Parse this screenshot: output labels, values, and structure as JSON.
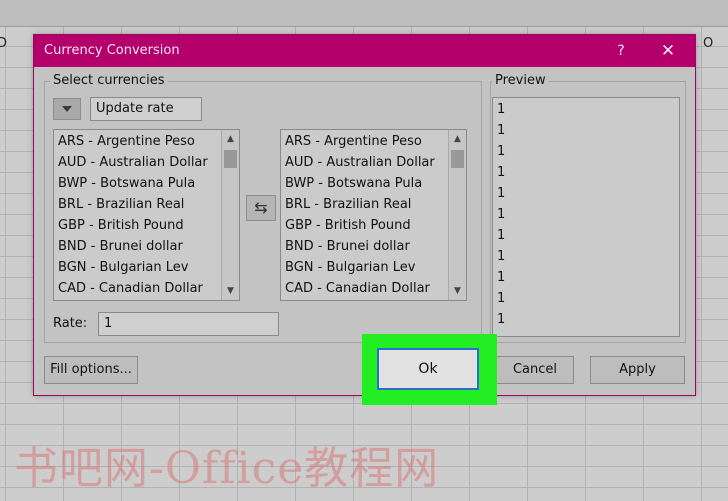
{
  "background": {
    "column_fragments": [
      "D",
      "O"
    ]
  },
  "dialog": {
    "title": "Currency Conversion",
    "help_label": "?",
    "close_label": "✕",
    "select_currencies_label": "Select currencies",
    "update_rate_label": "Update rate",
    "swap_label": "⇆",
    "left_list": [
      "ARS - Argentine Peso",
      "AUD - Australian Dollar",
      "BWP - Botswana Pula",
      "BRL - Brazilian Real",
      "GBP - British Pound",
      "BND - Brunei dollar",
      "BGN - Bulgarian Lev",
      "CAD - Canadian Dollar"
    ],
    "right_list": [
      "ARS - Argentine Peso",
      "AUD - Australian Dollar",
      "BWP - Botswana Pula",
      "BRL - Brazilian Real",
      "GBP - British Pound",
      "BND - Brunei dollar",
      "BGN - Bulgarian Lev",
      "CAD - Canadian Dollar"
    ],
    "rate_label": "Rate:",
    "rate_value": "1",
    "preview_label": "Preview",
    "preview_values": [
      "1",
      "1",
      "1",
      "1",
      "1",
      "1",
      "1",
      "1",
      "1",
      "1",
      "1"
    ],
    "fill_options_label": "Fill options...",
    "ok_label": "Ok",
    "cancel_label": "Cancel",
    "apply_label": "Apply"
  },
  "watermark": "书吧网-Office教程网",
  "colors": {
    "titlebar": "#b4006b",
    "highlight": "#22ee22",
    "focus_border": "#2a6fcf"
  }
}
